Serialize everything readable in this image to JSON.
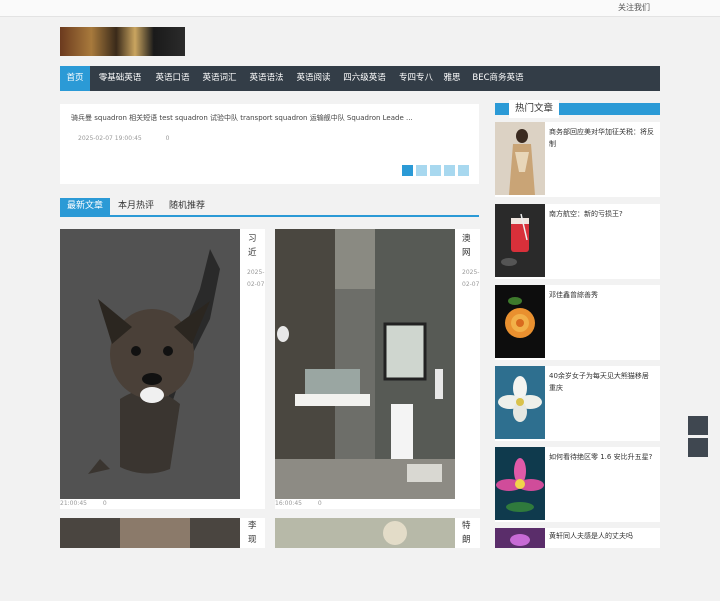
{
  "topbar": {
    "follow_label": "关注我们"
  },
  "nav": {
    "items": [
      {
        "label": "首页",
        "active": true
      },
      {
        "label": "零基础英语"
      },
      {
        "label": "英语口语"
      },
      {
        "label": "英语词汇"
      },
      {
        "label": "英语语法"
      },
      {
        "label": "英语阅读"
      },
      {
        "label": "四六级英语"
      },
      {
        "label": "专四专八"
      },
      {
        "label": "雅思"
      },
      {
        "label": "BEC商务英语"
      }
    ]
  },
  "slider": {
    "text": "骑兵曼   squadron 相关短语    test squadron 试验中队  transport squadron 运输舰中队 Squadron Leade ...",
    "date": "2025-02-07 19:00:45",
    "count": "0",
    "active_dot": 1,
    "dot_count": 5
  },
  "tabs": [
    {
      "label": "最新文章",
      "active": true
    },
    {
      "label": "本月热评"
    },
    {
      "label": "随机推荐"
    }
  ],
  "articles": [
    {
      "title": "习近",
      "date": "2025-02-07",
      "time": "21:00:45",
      "count": "0"
    },
    {
      "title": "澳网",
      "date": "2025-02-07",
      "time": "16:00:45",
      "count": "0"
    },
    {
      "title": "李现"
    },
    {
      "title": "特朗"
    }
  ],
  "hot": {
    "heading": "热门文章",
    "items": [
      {
        "title": "商务部回应美对华加征关税：将反制"
      },
      {
        "title": "南方航空：新的亏损王?"
      },
      {
        "title": "邓佳鑫曾綜善秀"
      },
      {
        "title": "40余岁女子为每天见大熊猫移居重庆"
      },
      {
        "title": "如何看待绝区零 1.6 安比升五星?"
      },
      {
        "title": "黄轩同人夫感是人的丈夫吗"
      }
    ]
  },
  "colors": {
    "accent": "#2b9ad6",
    "nav_bg": "#333d47",
    "dot_light": "#a8d8ef"
  },
  "side_buttons": [
    {
      "icon": "square-icon"
    },
    {
      "icon": "square-icon"
    }
  ]
}
